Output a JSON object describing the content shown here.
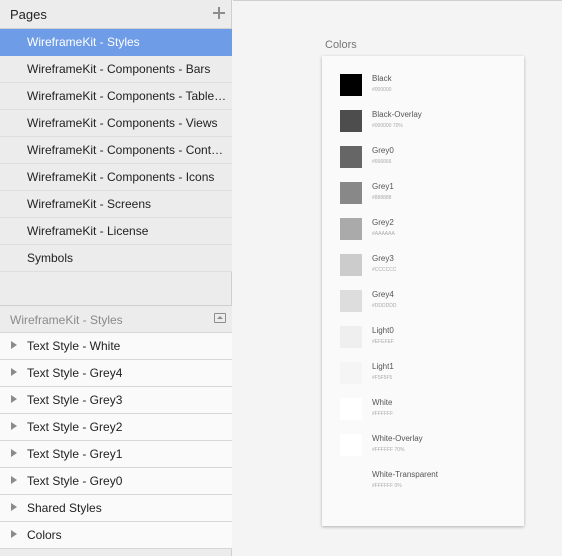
{
  "sidebar": {
    "pages_title": "Pages",
    "pages": [
      {
        "label": "WireframeKit - Styles",
        "selected": true
      },
      {
        "label": "WireframeKit - Components - Bars",
        "selected": false
      },
      {
        "label": "WireframeKit - Components - Table…",
        "selected": false
      },
      {
        "label": "WireframeKit - Components - Views",
        "selected": false
      },
      {
        "label": "WireframeKit - Components - Cont…",
        "selected": false
      },
      {
        "label": "WireframeKit - Components - Icons",
        "selected": false
      },
      {
        "label": "WireframeKit - Screens",
        "selected": false
      },
      {
        "label": "WireframeKit - License",
        "selected": false
      },
      {
        "label": "Symbols",
        "selected": false
      }
    ],
    "layers_title": "WireframeKit - Styles",
    "layers": [
      {
        "label": "Text Style - White"
      },
      {
        "label": "Text Style - Grey4"
      },
      {
        "label": "Text Style - Grey3"
      },
      {
        "label": "Text Style - Grey2"
      },
      {
        "label": "Text Style - Grey1"
      },
      {
        "label": "Text Style - Grey0"
      },
      {
        "label": "Shared Styles"
      },
      {
        "label": "Colors"
      }
    ],
    "icons": {
      "add": "plus-icon",
      "collapse": "collapse-panel-icon",
      "disclosure": "disclosure-triangle-icon"
    }
  },
  "canvas": {
    "artboard_title": "Colors",
    "swatches": [
      {
        "name": "Black",
        "code": "#000000",
        "color": "#000000"
      },
      {
        "name": "Black-Overlay",
        "code": "#000000 70%",
        "color": "#4d4d4d"
      },
      {
        "name": "Grey0",
        "code": "#666666",
        "color": "#666666"
      },
      {
        "name": "Grey1",
        "code": "#888888",
        "color": "#888888"
      },
      {
        "name": "Grey2",
        "code": "#AAAAAA",
        "color": "#aaaaaa"
      },
      {
        "name": "Grey3",
        "code": "#CCCCCC",
        "color": "#cccccc"
      },
      {
        "name": "Grey4",
        "code": "#DDDDDD",
        "color": "#dddddd"
      },
      {
        "name": "Light0",
        "code": "#EFEFEF",
        "color": "#efefef"
      },
      {
        "name": "Light1",
        "code": "#F5F5F5",
        "color": "#f5f5f5"
      },
      {
        "name": "White",
        "code": "#FFFFFF",
        "color": "#ffffff"
      },
      {
        "name": "White-Overlay",
        "code": "#FFFFFF 70%",
        "color": "#ffffff"
      },
      {
        "name": "White-Transparent",
        "code": "#FFFFFF 0%",
        "color": "transparent"
      }
    ]
  },
  "colors": {
    "selection": "#6f9ce6",
    "sidebar_bg": "#ececec",
    "canvas_bg": "#f4f4f4"
  }
}
